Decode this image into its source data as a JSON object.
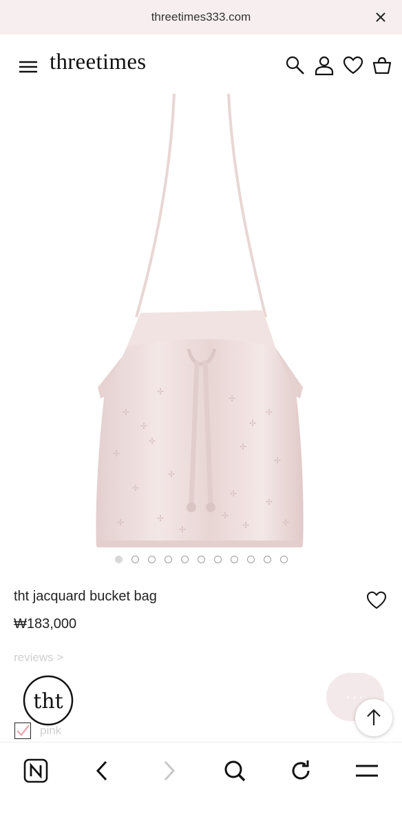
{
  "browser": {
    "url": "threetimes333.com"
  },
  "header": {
    "logo": "threetimes"
  },
  "product": {
    "name": "tht jacquard bucket bag",
    "price": "₩183,000",
    "reviews_link": "reviews >",
    "image_count": 11,
    "active_image_index": 0,
    "option": {
      "label": "pink",
      "checked": true
    }
  },
  "brand_badge": {
    "text": "tht"
  },
  "chat": {
    "label": "···"
  },
  "colors": {
    "url_bar": "#f7eeef",
    "bag": "#ead7d6",
    "chat_button": "#f4e9ea",
    "muted_text": "#cfcfcf",
    "checkmark": "#e9a9b0"
  }
}
